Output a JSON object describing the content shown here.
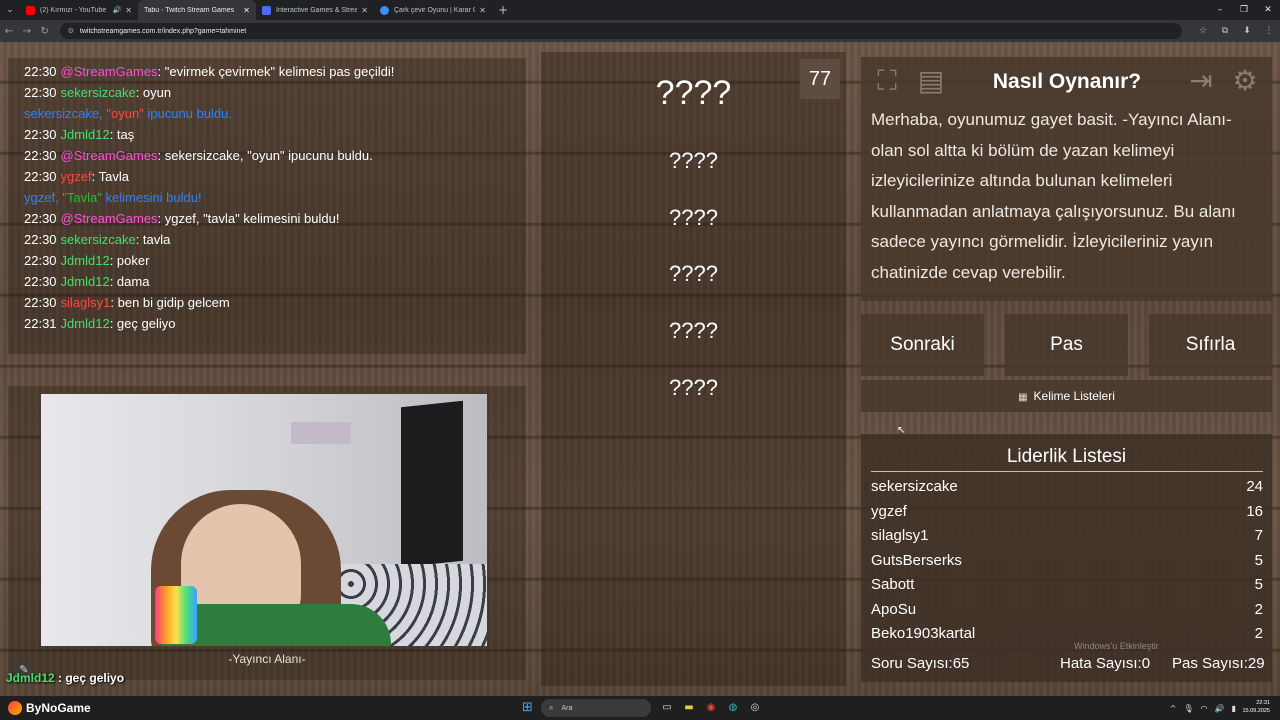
{
  "browser": {
    "tabs": [
      {
        "title": "(2) Kırmızı - YouTube",
        "favicon_color": "#ff0000",
        "active": false,
        "audio": true
      },
      {
        "title": "Tabu - Twitch Stream Games",
        "favicon_color": "#35363a",
        "active": true,
        "audio": false
      },
      {
        "title": "Interactive Games & Streaming",
        "favicon_color": "#4a6cf7",
        "active": false,
        "audio": false
      },
      {
        "title": "Çark çevir Oyunu | Karar Çarkı",
        "favicon_color": "#3e8ef7",
        "active": false,
        "audio": false
      }
    ],
    "url": "twitchstreamgames.com.tr/index.php?game=tahminet"
  },
  "chat": {
    "messages": [
      {
        "time": "22:30",
        "user": "@StreamGames",
        "user_color": "pink",
        "text": ": \"evirmek çevirmek\" kelimesi pas geçildi!"
      },
      {
        "time": "22:30",
        "user": "sekersizcake",
        "user_color": "green",
        "text": ": oyun"
      },
      {
        "time": "",
        "user": "sekersizcake, ",
        "user_color": "blue",
        "word": "\"oyun\"",
        "text": " ipucunu buldu.",
        "system": true
      },
      {
        "time": "22:30",
        "user": "Jdmld12",
        "user_color": "green",
        "text": ": taş"
      },
      {
        "time": "22:30",
        "user": "@StreamGames",
        "user_color": "pink",
        "text": ": sekersizcake, \"oyun\" ipucunu buldu."
      },
      {
        "time": "22:30",
        "user": "ygzef",
        "user_color": "red",
        "text": ": Tavla"
      },
      {
        "time": "",
        "user": "ygzef, ",
        "user_color": "blue",
        "word": "\"Tavla\"",
        "text": " kelimesini buldu!",
        "system": true
      },
      {
        "time": "22:30",
        "user": "@StreamGames",
        "user_color": "pink",
        "text": ": ygzef, \"tavla\" kelimesini buldu!"
      },
      {
        "time": "22:30",
        "user": "sekersizcake",
        "user_color": "green",
        "text": ": tavla"
      },
      {
        "time": "22:30",
        "user": "Jdmld12",
        "user_color": "green",
        "text": ": poker"
      },
      {
        "time": "22:30",
        "user": "Jdmld12",
        "user_color": "green",
        "text": ": dama"
      },
      {
        "time": "22:30",
        "user": "silaglsy1",
        "user_color": "red",
        "text": ": ben bi gidip gelcem"
      },
      {
        "time": "22:31",
        "user": "Jdmld12",
        "user_color": "green",
        "text": ": geç geliyo"
      }
    ]
  },
  "streamer": {
    "label": "-Yayıncı Alanı-",
    "overlay_user": "Jdmld12",
    "overlay_text": " : geç geliyo"
  },
  "words": {
    "counter": "77",
    "main": "????",
    "hints": [
      "????",
      "????",
      "????",
      "????",
      "????"
    ]
  },
  "info": {
    "title": "Nasıl Oynanır?",
    "text": "Merhaba, oyunumuz gayet basit. -Yayıncı Alanı- olan sol altta ki bölüm de yazan kelimeyi izleyicilerinize altında bulunan kelimeleri kullanmadan anlatmaya çalışıyorsunuz. Bu alanı sadece yayıncı görmelidir. İzleyicileriniz yayın chatinizde cevap verebilir."
  },
  "controls": {
    "next": "Sonraki",
    "pass": "Pas",
    "reset": "Sıfırla",
    "word_lists": "Kelime Listeleri"
  },
  "leaderboard": {
    "title": "Liderlik Listesi",
    "rows": [
      {
        "name": "sekersizcake",
        "score": "24"
      },
      {
        "name": "ygzef",
        "score": "16"
      },
      {
        "name": "silaglsy1",
        "score": "7"
      },
      {
        "name": "GutsBerserks",
        "score": "5"
      },
      {
        "name": "Sabott",
        "score": "5"
      },
      {
        "name": "ApoSu",
        "score": "2"
      },
      {
        "name": "Beko1903kartal",
        "score": "2"
      }
    ],
    "stats": {
      "questions": "Soru Sayısı:65",
      "errors": "Hata Sayısı:0",
      "passes": "Pas Sayısı:29"
    }
  },
  "watermark": "Windows'u Etkinleştir",
  "taskbar": {
    "brand": "ByNoGame",
    "search_placeholder": "Ara",
    "time": "22:31",
    "date": "15.09.2025"
  },
  "colors": {
    "pink": "#ff4fd8",
    "green": "#44e06a",
    "red": "#ff4a3d",
    "blue": "#2f82ff",
    "word_highlight": "#ff4a3d"
  }
}
